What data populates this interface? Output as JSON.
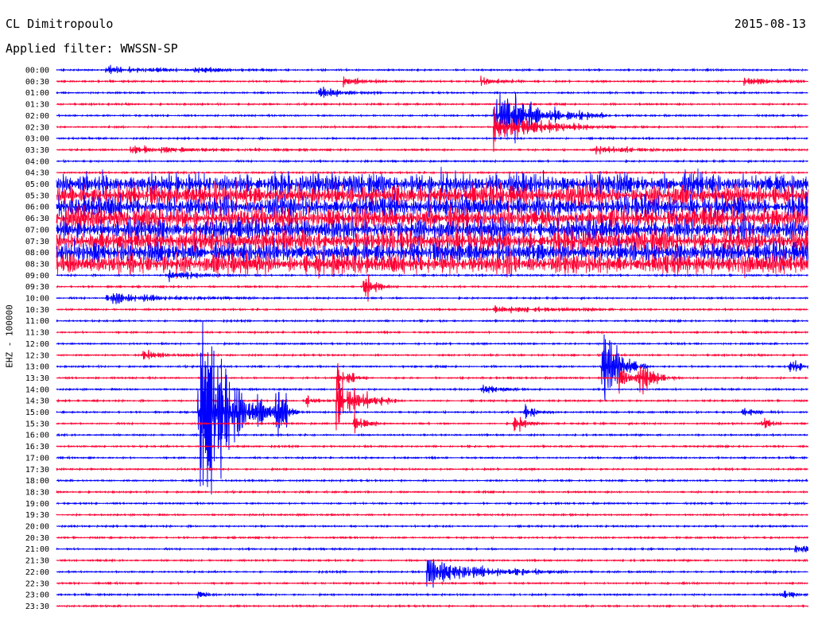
{
  "header": {
    "station": "CL Dimitropoulo",
    "date": "2015-08-13",
    "filter": "Applied filter: WWSSN-SP"
  },
  "chart_data": {
    "type": "line",
    "ylabel": "EHZ - 100000",
    "colors": [
      "#0000ff",
      "#ff0033"
    ],
    "rows": [
      "00:00",
      "00:30",
      "01:00",
      "01:30",
      "02:00",
      "02:30",
      "03:00",
      "03:30",
      "04:00",
      "04:30",
      "05:00",
      "05:30",
      "06:00",
      "06:30",
      "07:00",
      "07:30",
      "08:00",
      "08:30",
      "09:00",
      "09:30",
      "10:00",
      "10:30",
      "11:00",
      "11:30",
      "12:00",
      "12:30",
      "13:00",
      "13:30",
      "14:00",
      "14:30",
      "15:00",
      "15:30",
      "16:00",
      "16:30",
      "17:00",
      "17:30",
      "18:00",
      "18:30",
      "19:00",
      "19:30",
      "20:00",
      "20:30",
      "21:00",
      "21:30",
      "22:00",
      "22:30",
      "23:00",
      "23:30"
    ],
    "noisy_rows": [
      "05:00",
      "05:30",
      "06:00",
      "06:30",
      "07:00",
      "07:30",
      "08:00",
      "08:30"
    ],
    "events": [
      {
        "row": "00:00",
        "minute": 2.0,
        "amp": 0.35,
        "dur": 1.5
      },
      {
        "row": "00:00",
        "minute": 5.5,
        "amp": 0.25,
        "dur": 1.2
      },
      {
        "row": "00:30",
        "minute": 11.5,
        "amp": 0.3,
        "dur": 0.8
      },
      {
        "row": "00:30",
        "minute": 17.0,
        "amp": 0.3,
        "dur": 0.8
      },
      {
        "row": "00:30",
        "minute": 27.5,
        "amp": 0.45,
        "dur": 0.8
      },
      {
        "row": "01:00",
        "minute": 10.5,
        "amp": 0.45,
        "dur": 0.9
      },
      {
        "row": "02:00",
        "minute": 17.5,
        "amp": 3.0,
        "dur": 1.5
      },
      {
        "row": "02:30",
        "minute": 17.5,
        "amp": 1.6,
        "dur": 1.6
      },
      {
        "row": "03:30",
        "minute": 3.0,
        "amp": 0.3,
        "dur": 2.5
      },
      {
        "row": "03:30",
        "minute": 21.5,
        "amp": 0.35,
        "dur": 1.5
      },
      {
        "row": "09:00",
        "minute": 4.5,
        "amp": 0.5,
        "dur": 1.0
      },
      {
        "row": "09:30",
        "minute": 12.3,
        "amp": 1.2,
        "dur": 0.4
      },
      {
        "row": "10:00",
        "minute": 2.0,
        "amp": 0.45,
        "dur": 2.0
      },
      {
        "row": "10:30",
        "minute": 17.5,
        "amp": 0.35,
        "dur": 2.0
      },
      {
        "row": "12:30",
        "minute": 3.5,
        "amp": 0.4,
        "dur": 0.8
      },
      {
        "row": "13:00",
        "minute": 21.8,
        "amp": 5.0,
        "dur": 0.6
      },
      {
        "row": "13:00",
        "minute": 29.3,
        "amp": 0.5,
        "dur": 0.8
      },
      {
        "row": "13:30",
        "minute": 11.2,
        "amp": 1.5,
        "dur": 0.4
      },
      {
        "row": "13:30",
        "minute": 22.5,
        "amp": 1.3,
        "dur": 0.6
      },
      {
        "row": "13:30",
        "minute": 23.3,
        "amp": 1.1,
        "dur": 0.5
      },
      {
        "row": "14:00",
        "minute": 17.0,
        "amp": 0.6,
        "dur": 0.5
      },
      {
        "row": "14:30",
        "minute": 11.2,
        "amp": 2.6,
        "dur": 0.8
      },
      {
        "row": "14:30",
        "minute": 10.0,
        "amp": 0.5,
        "dur": 0.4
      },
      {
        "row": "15:00",
        "minute": 5.7,
        "amp": 9.0,
        "dur": 1.2
      },
      {
        "row": "15:00",
        "minute": 8.8,
        "amp": 2.4,
        "dur": 0.3
      },
      {
        "row": "15:00",
        "minute": 18.7,
        "amp": 0.8,
        "dur": 0.4
      },
      {
        "row": "15:00",
        "minute": 27.4,
        "amp": 0.4,
        "dur": 0.5
      },
      {
        "row": "15:30",
        "minute": 11.9,
        "amp": 0.9,
        "dur": 0.4
      },
      {
        "row": "15:30",
        "minute": 18.3,
        "amp": 0.8,
        "dur": 0.4
      },
      {
        "row": "15:30",
        "minute": 28.2,
        "amp": 0.6,
        "dur": 0.3
      },
      {
        "row": "21:00",
        "minute": 29.5,
        "amp": 0.3,
        "dur": 1.0
      },
      {
        "row": "22:00",
        "minute": 14.8,
        "amp": 1.2,
        "dur": 2.0
      },
      {
        "row": "23:00",
        "minute": 5.7,
        "amp": 0.4,
        "dur": 0.3
      },
      {
        "row": "23:00",
        "minute": 29.0,
        "amp": 0.5,
        "dur": 0.4
      }
    ]
  }
}
